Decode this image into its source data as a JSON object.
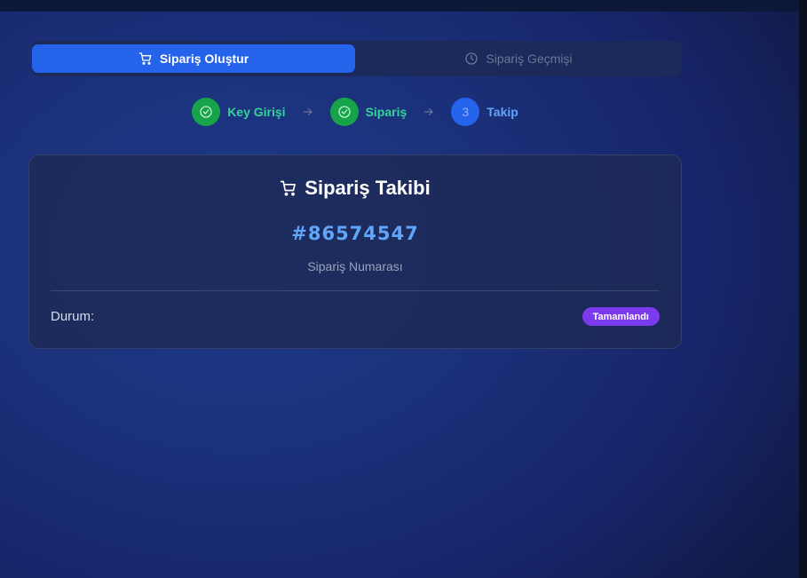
{
  "tabs": [
    {
      "label": "Sipariş Oluştur",
      "icon": "cart-icon",
      "active": true
    },
    {
      "label": "Sipariş Geçmişi",
      "icon": "clock-icon",
      "active": false
    }
  ],
  "steps": [
    {
      "label": "Key Girişi",
      "state": "done",
      "icon": "check-circle-icon"
    },
    {
      "label": "Sipariş",
      "state": "done",
      "icon": "check-circle-icon"
    },
    {
      "label": "Takip",
      "state": "current",
      "number": "3"
    }
  ],
  "card": {
    "title": "Sipariş Takibi",
    "order_number": "#86574547",
    "order_number_label": "Sipariş Numarası",
    "status_label": "Durum:",
    "status_value": "Tamamlandı"
  },
  "colors": {
    "primary": "#2563eb",
    "success": "#16a34a",
    "badge": "#7c3aed",
    "link": "#60a5fa"
  }
}
